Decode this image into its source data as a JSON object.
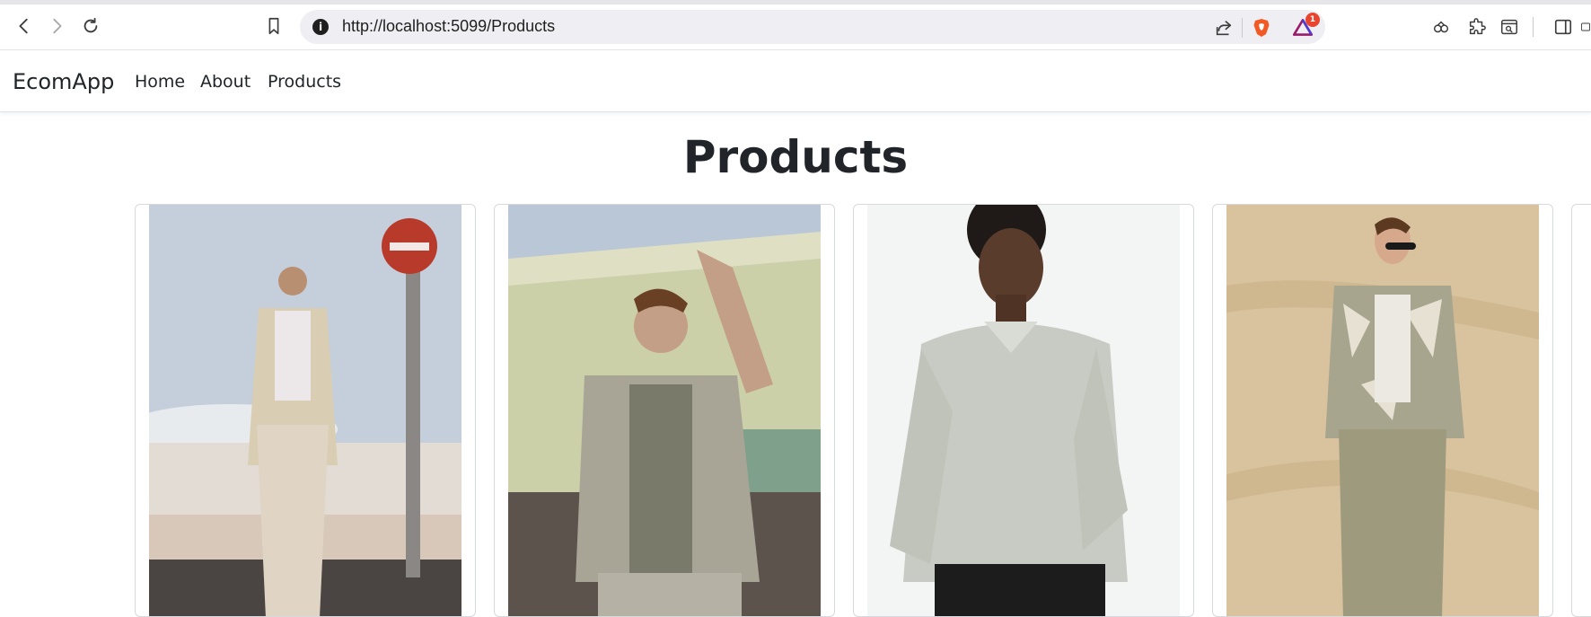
{
  "browser": {
    "url": "http://localhost:5099/Products",
    "notification_count": "1",
    "icons": [
      "back-icon",
      "forward-icon",
      "reload-icon",
      "bookmark-icon",
      "site-info-icon",
      "share-icon",
      "brave-shields-icon",
      "brave-rewards-icon",
      "leo-ai-icon",
      "extensions-icon",
      "tab-search-icon",
      "sidebar-icon"
    ]
  },
  "navbar": {
    "brand": "EcomApp",
    "links": [
      "Home",
      "About",
      "Products"
    ]
  },
  "page": {
    "title": "Products"
  },
  "products": [
    {
      "image": "man-in-striped-overshirt-photo",
      "background": "#c9d3de"
    },
    {
      "image": "man-in-linen-shirt-photo",
      "background": "#cfd3a9"
    },
    {
      "image": "man-in-light-green-shirt-photo",
      "background": "#f3f4f4"
    },
    {
      "image": "man-in-printed-shirt-photo",
      "background": "#d8c19a"
    }
  ]
}
